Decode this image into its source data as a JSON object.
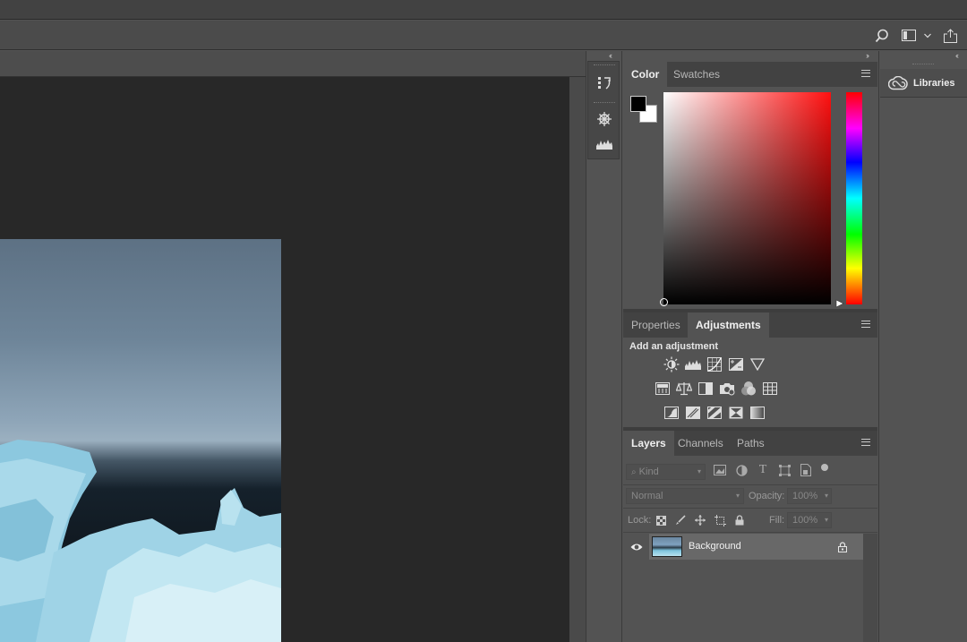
{
  "panels": {
    "color_group": {
      "tabs": [
        {
          "label": "Color",
          "active": true
        },
        {
          "label": "Swatches",
          "active": false
        }
      ],
      "foreground_color": "#000000",
      "background_color": "#ffffff",
      "hue_color": "#ff1010"
    },
    "adjustments_group": {
      "tabs": [
        {
          "label": "Properties",
          "active": false
        },
        {
          "label": "Adjustments",
          "active": true
        }
      ],
      "heading": "Add an adjustment",
      "icons_row1": [
        "brightness-contrast-icon",
        "levels-icon",
        "curves-icon",
        "exposure-icon",
        "vibrance-icon"
      ],
      "icons_row2": [
        "hue-saturation-icon",
        "color-balance-icon",
        "black-white-icon",
        "photo-filter-icon",
        "channel-mixer-icon",
        "color-lookup-icon"
      ],
      "icons_row3": [
        "invert-icon",
        "posterize-icon",
        "threshold-icon",
        "selective-color-icon",
        "gradient-map-icon"
      ]
    },
    "layers_group": {
      "tabs": [
        {
          "label": "Layers",
          "active": true
        },
        {
          "label": "Channels",
          "active": false
        },
        {
          "label": "Paths",
          "active": false
        }
      ],
      "filter_placeholder": "Kind",
      "blend_mode": "Normal",
      "opacity_label": "Opacity:",
      "opacity_value": "100%",
      "lock_label": "Lock:",
      "fill_label": "Fill:",
      "fill_value": "100%",
      "layers": [
        {
          "name": "Background",
          "visible": true,
          "locked": true
        }
      ]
    },
    "libraries": {
      "label": "Libraries"
    }
  },
  "colors": {
    "app_bg": "#535353",
    "canvas_bg": "#282828",
    "panel_tab_bg": "#424242"
  }
}
